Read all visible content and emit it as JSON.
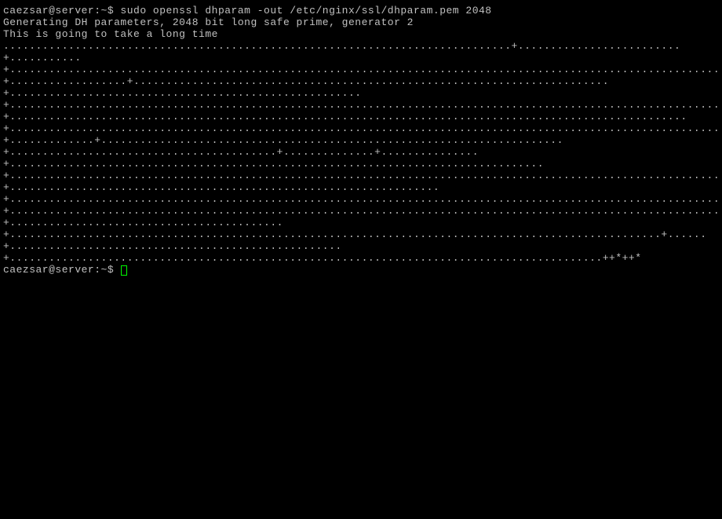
{
  "prompt1": {
    "user_host": "caezsar@server:~$",
    "command": " sudo openssl dhparam -out /etc/nginx/ssl/dhparam.pem 2048"
  },
  "output1": "Generating DH parameters, 2048 bit long safe prime, generator 2",
  "output2": "This is going to take a long time",
  "dots": "..............................................................................+.........................+...........+................................................................................................................................................................................................+..................+.........................................................................+......................................................+.................................................................................................................................................+........................................................................................................+...........................................................................................................................................................+.............+.......................................................................+.........................................+..............+...............+..................................................................................+....................................................................................................................................................................................................................................................................................................................+..................................................................+.........................................................................................................................................................................................................................................................................................................................+.....................................................................................................................................................................................................................................................................................................................................................................................................................................................................+..........................................+....................................................................................................+......+...................................................+...........................................................................................++*++*",
  "prompt2": {
    "user_host": "caezsar@server:~$"
  }
}
